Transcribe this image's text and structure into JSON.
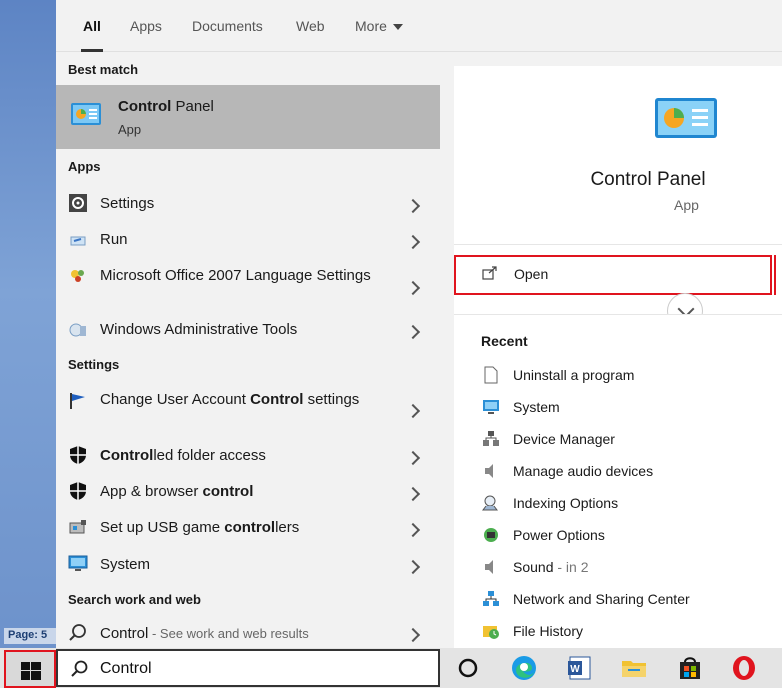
{
  "desktop": {
    "page_indicator": "Page: 5"
  },
  "tabs": [
    {
      "label": "All",
      "active": true
    },
    {
      "label": "Apps",
      "active": false
    },
    {
      "label": "Documents",
      "active": false
    },
    {
      "label": "Web",
      "active": false
    },
    {
      "label": "More",
      "active": false
    }
  ],
  "sections": {
    "best_match": "Best match",
    "apps": "Apps",
    "settings": "Settings",
    "search_web": "Search work and web"
  },
  "best_match": {
    "title_bold": "Control",
    "title_rest": " Panel",
    "subtitle": "App",
    "icon": "control-panel-icon"
  },
  "apps": [
    {
      "label": "Settings",
      "icon": "gear-icon"
    },
    {
      "label": "Run",
      "icon": "run-icon"
    },
    {
      "label": "Microsoft Office 2007 Language Settings",
      "icon": "office-language-icon"
    },
    {
      "label": "Windows Administrative Tools",
      "icon": "admin-tools-icon"
    }
  ],
  "settings": [
    {
      "pre": "Change User Account ",
      "bold": "Control",
      "post": " settings",
      "icon": "flag-icon"
    },
    {
      "pre": "",
      "bold": "Control",
      "post": "led folder access",
      "icon": "shield-icon"
    },
    {
      "pre": "App & browser ",
      "bold": "control",
      "post": "",
      "icon": "shield-icon"
    },
    {
      "pre": "Set up USB game ",
      "bold": "control",
      "post": "lers",
      "icon": "usb-game-icon"
    },
    {
      "pre": "System",
      "bold": "",
      "post": "",
      "icon": "monitor-icon"
    }
  ],
  "web": {
    "query": "Control",
    "hint": " - See work and web results",
    "icon": "search-icon"
  },
  "preview": {
    "title": "Control Panel",
    "subtitle": "App",
    "open_label": "Open",
    "recent_title": "Recent",
    "recent": [
      {
        "label": "Uninstall a program",
        "extra": "",
        "icon": "document-icon"
      },
      {
        "label": "System",
        "extra": "",
        "icon": "monitor-icon"
      },
      {
        "label": "Device Manager",
        "extra": "",
        "icon": "device-manager-icon"
      },
      {
        "label": "Manage audio devices",
        "extra": "",
        "icon": "speaker-icon"
      },
      {
        "label": "Indexing Options",
        "extra": "",
        "icon": "indexing-icon"
      },
      {
        "label": "Power Options",
        "extra": "",
        "icon": "power-icon"
      },
      {
        "label": "Sound",
        "extra": " - in 2",
        "icon": "speaker-icon"
      },
      {
        "label": "Network and Sharing Center",
        "extra": "",
        "icon": "network-icon"
      },
      {
        "label": "File History",
        "extra": "",
        "icon": "file-history-icon"
      }
    ]
  },
  "taskbar": {
    "search_value": "Control",
    "apps": [
      "cortana-icon",
      "edge-icon",
      "word-icon",
      "file-explorer-icon",
      "store-icon",
      "opera-icon"
    ]
  },
  "colors": {
    "highlight": "#e0141e",
    "selected_row": "#b7b7b7",
    "panel_bg": "#f2f2f2"
  }
}
